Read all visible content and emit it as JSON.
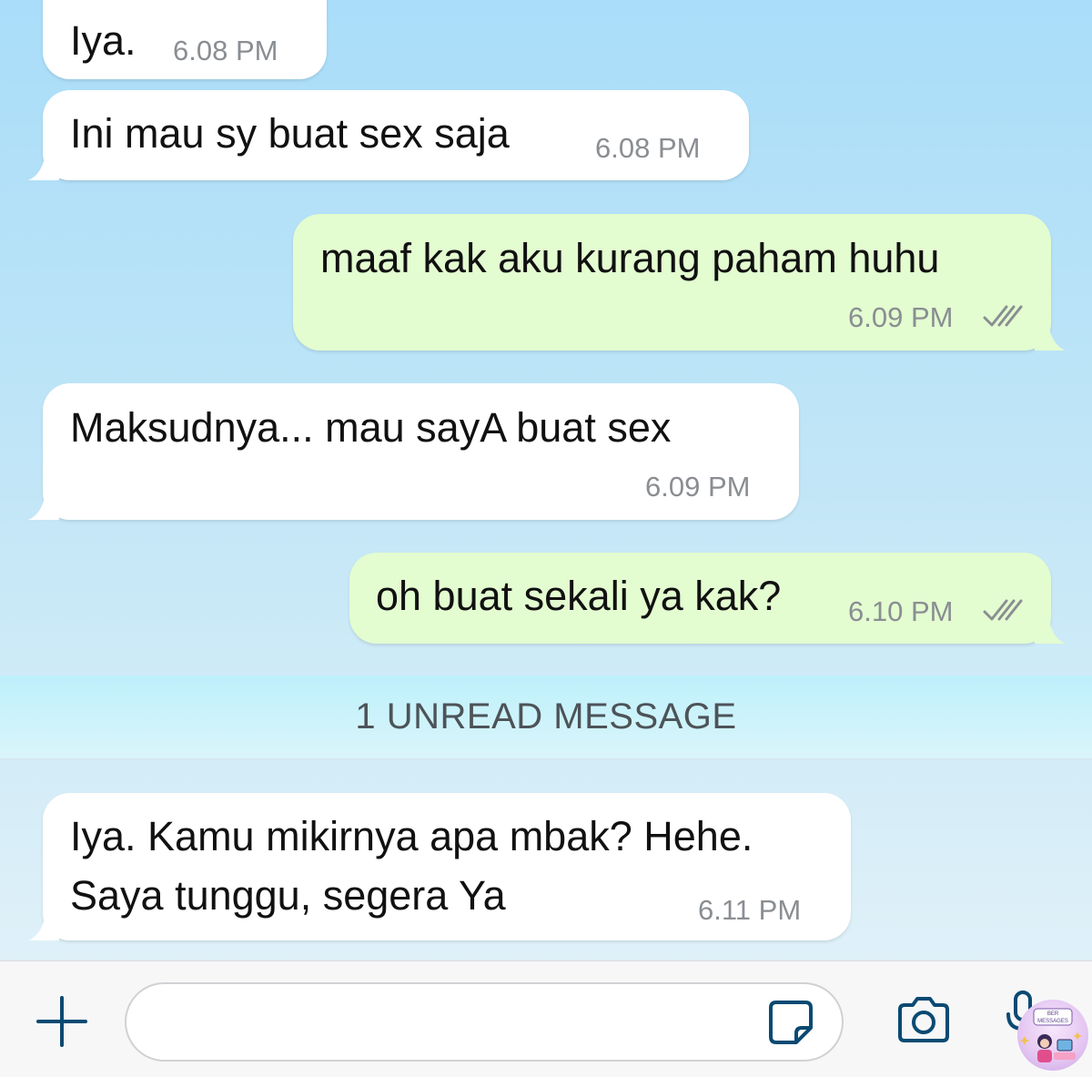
{
  "messages": [
    {
      "direction": "in",
      "text": "Iya.",
      "time": "6.08 PM"
    },
    {
      "direction": "in",
      "text": "Ini mau sy buat sex saja",
      "time": "6.08 PM"
    },
    {
      "direction": "out",
      "text": "maaf kak aku kurang paham huhu",
      "time": "6.09 PM",
      "status": "read"
    },
    {
      "direction": "in",
      "text": "Maksudnya... mau sayA buat sex",
      "time": "6.09 PM"
    },
    {
      "direction": "out",
      "text": "oh buat sekali ya kak?",
      "time": "6.10 PM",
      "status": "read"
    },
    {
      "direction": "in",
      "lines": [
        "Iya. Kamu mikirnya apa mbak? Hehe.",
        "Saya tunggu, segera Ya"
      ],
      "time": "6.11 PM"
    }
  ],
  "unread_divider": "1 UNREAD MESSAGE",
  "input_bar": {
    "placeholder": "",
    "icons": [
      "plus-icon",
      "sticker-icon",
      "camera-icon",
      "microphone-icon"
    ]
  },
  "watermark": {
    "lines": [
      "BER",
      "MESSAGES"
    ]
  },
  "colors": {
    "incoming_bubble": "#ffffff",
    "outgoing_bubble": "#e3fcd0",
    "timestamp": "#8a8e92",
    "read_ticks": "#8a8e92",
    "icon_stroke": "#0a4a72"
  }
}
